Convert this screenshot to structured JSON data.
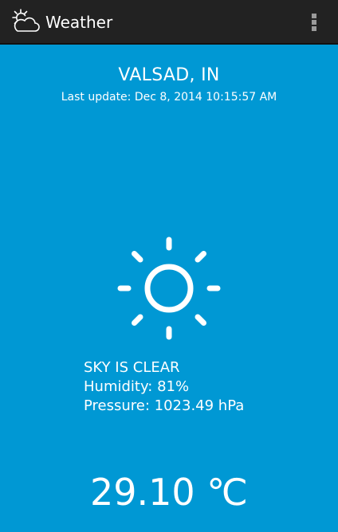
{
  "action_bar": {
    "title": "Weather",
    "app_icon": "sun-cloud-icon",
    "menu_icon": "overflow-menu-icon",
    "background": "#222222"
  },
  "location": {
    "city": "VALSAD, IN",
    "last_update": "Last update: Dec 8, 2014 10:15:57 AM"
  },
  "conditions": {
    "icon": "sun-icon",
    "description": "SKY IS CLEAR",
    "humidity": "Humidity: 81%",
    "pressure": "Pressure: 1023.49 hPa"
  },
  "temperature": "29.10 ℃",
  "colors": {
    "background": "#0098d4",
    "text": "#ffffff"
  }
}
